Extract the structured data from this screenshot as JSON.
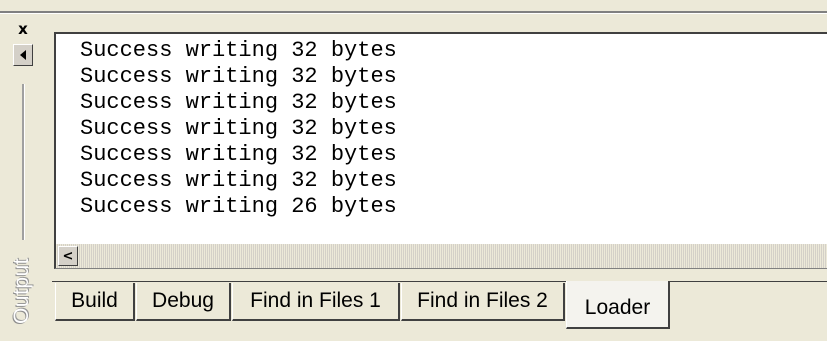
{
  "panel": {
    "title": "Output",
    "close_glyph": "x"
  },
  "output": {
    "lines": [
      "Success writing 32 bytes",
      "Success writing 32 bytes",
      "Success writing 32 bytes",
      "Success writing 32 bytes",
      "Success writing 32 bytes",
      "Success writing 32 bytes",
      "Success writing 26 bytes"
    ]
  },
  "tabs": [
    {
      "label": "Build"
    },
    {
      "label": "Debug"
    },
    {
      "label": "Find in Files 1"
    },
    {
      "label": "Find in Files 2"
    },
    {
      "label": "Loader",
      "active": true
    }
  ],
  "icons": {
    "close": "close-icon",
    "scroll_left": "scroll-left-icon",
    "hscroll_left": "chevron-left-icon"
  }
}
